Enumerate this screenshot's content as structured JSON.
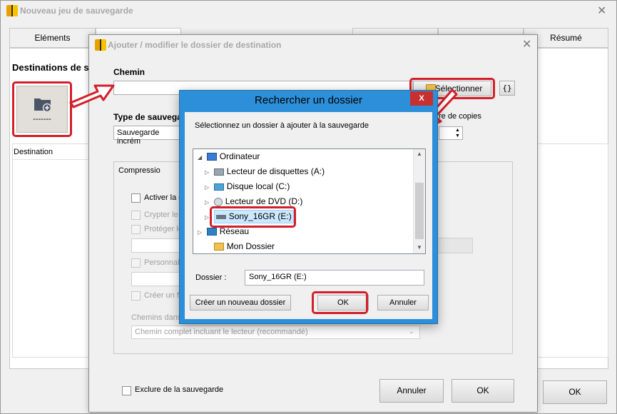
{
  "main_window": {
    "title": "Nouveau jeu de sauvegarde",
    "tabs": [
      "Eléments",
      "",
      "",
      "",
      "",
      "",
      "Résumé"
    ],
    "destinations_label": "Destinations de sa",
    "dest_button_label": "-------",
    "destination_column": "Destination",
    "ok_label": "OK"
  },
  "dest_dialog": {
    "title": "Ajouter / modifier le dossier de destination",
    "chemin_label": "Chemin",
    "chemin_value": "",
    "select_button": "Sélectionner",
    "braces_button": "{}",
    "type_label": "Type de sauvegar",
    "type_value": "Sauvegarde incrém",
    "copies_label": "re de copies",
    "compression_tab": "Compressio",
    "activer_label": "Activer la c",
    "crypter_label": "Crypter le",
    "proteger_label": "Protéger le",
    "personnaliser_label": "Personnali",
    "creer_label": "Créer un f",
    "chemins_label": "Chemins dans",
    "chemins_value": "Chemin complet incluant le lecteur (recommandé)",
    "exclure_label": "Exclure de la sauvegarde",
    "annuler_label": "Annuler",
    "ok_label": "OK"
  },
  "browse_dialog": {
    "title": "Rechercher un dossier",
    "instruction": "Sélectionnez un dossier à ajouter à la sauvegarde",
    "tree": [
      {
        "label": "Ordinateur",
        "icon": "computer-icon"
      },
      {
        "label": "Lecteur de disquettes (A:)",
        "icon": "floppy-drive-icon"
      },
      {
        "label": "Disque local (C:)",
        "icon": "hard-drive-icon"
      },
      {
        "label": "Lecteur de DVD (D:)",
        "icon": "dvd-drive-icon"
      },
      {
        "label": "Sony_16GR (E:)",
        "icon": "usb-drive-icon"
      },
      {
        "label": "Réseau",
        "icon": "network-icon"
      },
      {
        "label": "Mon Dossier",
        "icon": "folder-icon"
      }
    ],
    "dossier_label": "Dossier :",
    "dossier_value": "Sony_16GR (E:)",
    "new_folder_button": "Créer un nouveau dossier",
    "ok_label": "OK",
    "annuler_label": "Annuler",
    "close_label": "X"
  },
  "colors": {
    "highlight_red": "#d31f2a",
    "titlebar_blue": "#2d8fd9",
    "close_red": "#c7302f"
  }
}
